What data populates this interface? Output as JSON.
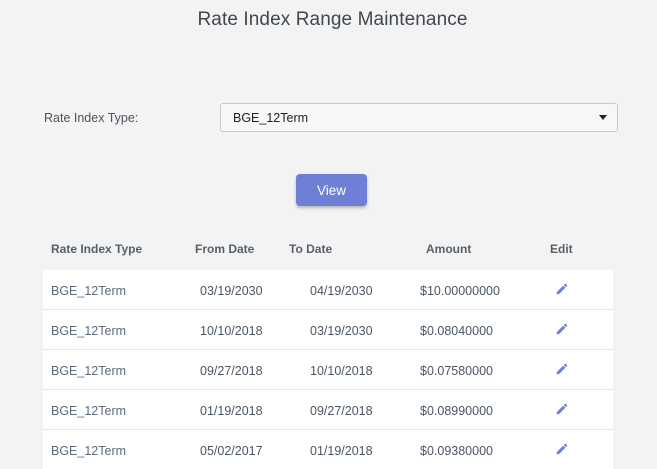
{
  "page": {
    "title": "Rate Index Range Maintenance"
  },
  "filter": {
    "label": "Rate Index Type:",
    "selected": "BGE_12Term"
  },
  "view_button": {
    "label": "View",
    "color": "#6e7fd6"
  },
  "table": {
    "headers": {
      "type": "Rate Index Type",
      "from": "From Date",
      "to": "To Date",
      "amount": "Amount",
      "edit": "Edit"
    },
    "rows": [
      {
        "type": "BGE_12Term",
        "from": "03/19/2030",
        "to": "04/19/2030",
        "amount": "$10.00000000",
        "edit_icon": "pencil-icon"
      },
      {
        "type": "BGE_12Term",
        "from": "10/10/2018",
        "to": "03/19/2030",
        "amount": "$0.08040000",
        "edit_icon": "pencil-icon"
      },
      {
        "type": "BGE_12Term",
        "from": "09/27/2018",
        "to": "10/10/2018",
        "amount": "$0.07580000",
        "edit_icon": "pencil-icon"
      },
      {
        "type": "BGE_12Term",
        "from": "01/19/2018",
        "to": "09/27/2018",
        "amount": "$0.08990000",
        "edit_icon": "pencil-icon"
      },
      {
        "type": "BGE_12Term",
        "from": "05/02/2017",
        "to": "01/19/2018",
        "amount": "$0.09380000",
        "edit_icon": "pencil-icon"
      }
    ],
    "edit_icon_color": "#6e7fd6"
  }
}
